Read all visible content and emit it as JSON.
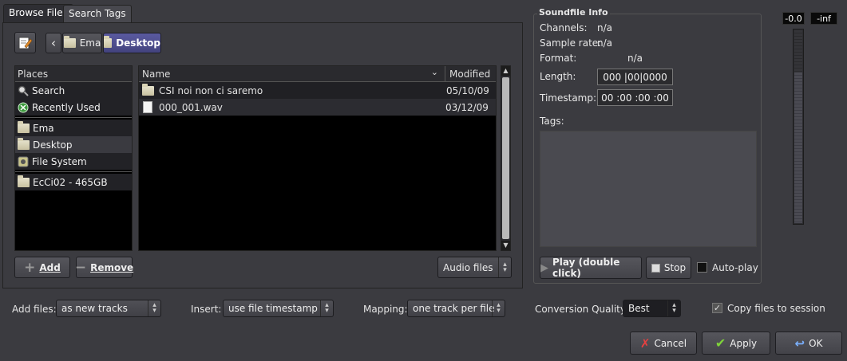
{
  "tabs": [
    "Browse Files",
    "Search Tags"
  ],
  "breadcrumb": {
    "back": "‹",
    "items": [
      "Ema",
      "Desktop"
    ]
  },
  "places": {
    "header": "Places",
    "items": [
      {
        "label": "Search",
        "icon": "search-icon"
      },
      {
        "label": "Recently Used",
        "icon": "recent-icon"
      },
      {
        "label": "Ema",
        "icon": "folder-icon"
      },
      {
        "label": "Desktop",
        "icon": "folder-icon"
      },
      {
        "label": "File System",
        "icon": "drive-icon"
      },
      {
        "label": "EcCi02 - 465GB",
        "icon": "folder-icon"
      }
    ],
    "add_label": "Add",
    "remove_label": "Remove"
  },
  "files": {
    "col_name": "Name",
    "col_modified": "Modified",
    "rows": [
      {
        "name": "CSI noi non ci saremo",
        "modified": "05/10/09",
        "icon": "folder-icon"
      },
      {
        "name": "000_001.wav",
        "modified": "03/12/09",
        "icon": "file-icon"
      }
    ],
    "filter": "Audio files"
  },
  "soundfile": {
    "title": "Soundfile Info",
    "channels_label": "Channels:",
    "channels": "n/a",
    "rate_label": "Sample rate:",
    "rate": "n/a",
    "format_label": "Format:",
    "format": "n/a",
    "length_label": "Length:",
    "length": "000 |00|0000",
    "timestamp_label": "Timestamp:",
    "timestamp": "00 :00 :00 :00",
    "tags_label": "Tags:",
    "play_label": "Play (double click)",
    "stop_label": "Stop",
    "autoplay_label": "Auto-play"
  },
  "meter": {
    "peak_left": "-0.0",
    "peak_right": "-inf"
  },
  "options": {
    "add_files_label": "Add files:",
    "add_files_value": "as new tracks",
    "insert_label": "Insert:",
    "insert_value": "use file timestamp",
    "mapping_label": "Mapping:",
    "mapping_value": "one track per file",
    "quality_label": "Conversion Quality:",
    "quality_value": "Best",
    "copy_label": "Copy files to session",
    "copy_checked": true
  },
  "actions": {
    "cancel": "Cancel",
    "apply": "Apply",
    "ok": "OK"
  },
  "colors": {
    "accent": "#4a4a8e",
    "background": "#3b3b40",
    "list_bg": "#000000"
  }
}
